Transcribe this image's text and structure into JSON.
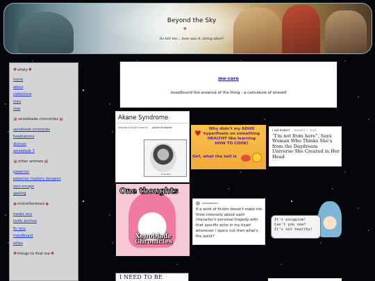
{
  "header": {
    "title": "Beyond the Sky",
    "subtitle": "So tell me... how was it, being alive?"
  },
  "sidebar": {
    "sections": [
      {
        "heading": "sitely",
        "links": [
          "home",
          "about",
          "collections",
          "links",
          "now"
        ]
      },
      {
        "heading": "xenoblade chronicles",
        "links": [
          "xenoblade chronicles",
          "headcanons",
          "dickson",
          "xenoblade 3"
        ]
      },
      {
        "heading": "other animes",
        "links": [
          "pokemon",
          "pokemon mystery dungeon",
          "zero escape",
          "gaoling"
        ]
      },
      {
        "heading": "miscellaneous",
        "links": [
          "media recs",
          "fanfic archive",
          "fic recs",
          "moodboard",
          "sillies"
        ]
      },
      {
        "heading": "things to find me",
        "links": []
      }
    ]
  },
  "intro": {
    "heading": "me-core",
    "desc_italic": "moodboard",
    "desc_rest": " the essence of the thing : a caricature of oneself"
  },
  "posts": {
    "akane": {
      "title_a": "Akane",
      "title_b": " Syndrome",
      "caption": "instead of brain there is",
      "caption_name": "Akane Kurashiki",
      "photo_label": "Lmly this"
    },
    "adhd": {
      "line1": "Why didn't my ADHD hyperfixate on something HEALTHY like learning HOW TO COOK!",
      "line2": "Girl, what the hell is"
    },
    "article": {
      "source": "I AM ROBOT",
      "date": "AUGUST 7, 2023",
      "headline": "“I'm not from here”, Says Woman Who Thinks She's from the Daydream Universe She Created in Her Head"
    },
    "onethoughts": {
      "title": "One thoughts",
      "logo": "Xenoblade Chronicles",
      "logo_sub": "Definitive Edition"
    },
    "quote": {
      "user": "hallowedsoul",
      "body": "If a work of fiction doesn't make me think intensely about each character's personal tragedy with that specific ache in my heart whenever i space out then what's the point?"
    },
    "escapism": {
      "line1": "It's escapism!",
      "line2": "Can't you see?",
      "line3": "It's not healthy!"
    },
    "violent": {
      "title": "I NEED TO BE VIOLENT"
    }
  }
}
